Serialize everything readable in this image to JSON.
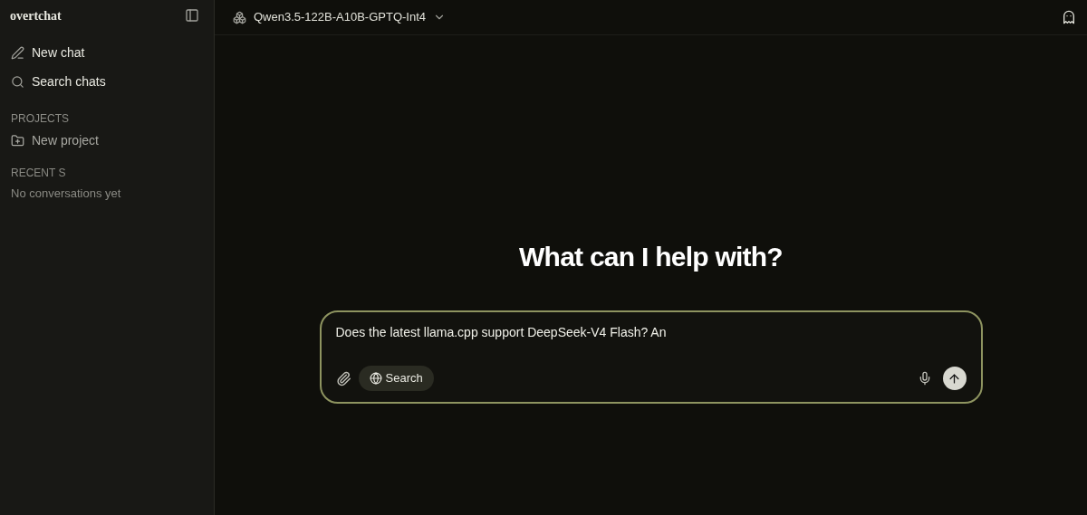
{
  "sidebar": {
    "brand": "overtchat",
    "actions": [
      {
        "kind": "new",
        "label": "New chat"
      },
      {
        "kind": "search",
        "label": "Search chats"
      }
    ],
    "projects": {
      "heading": "PROJECTS",
      "items": [
        {
          "label": "New project"
        }
      ]
    },
    "recents": {
      "heading": "RECENT S",
      "empty": "No conversations yet"
    }
  },
  "header": {
    "model": "Qwen3.5-122B-A10B-GPTQ-Int4"
  },
  "main": {
    "heading": "What can I help with?",
    "composer": {
      "value": "Does the latest llama.cpp support DeepSeek-V4 Flash? An",
      "search_label": "Search"
    }
  }
}
